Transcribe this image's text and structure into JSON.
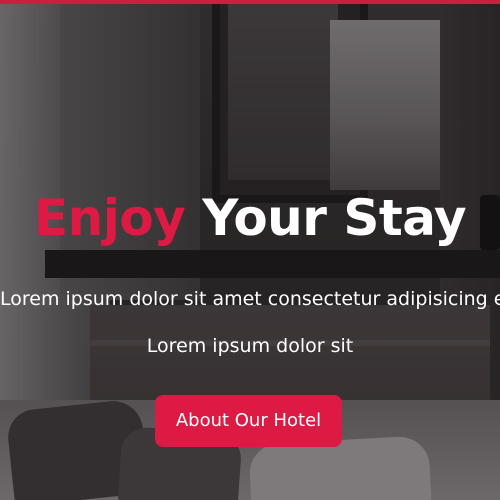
{
  "hero": {
    "title_accent": "Enjoy",
    "title_main": "Your Stay",
    "subtitle_line_1": "Lorem ipsum dolor sit amet consectetur adipisicing elit. Accusamus illo a",
    "subtitle_line_2": "Lorem ipsum dolor sit",
    "cta_label": "About Our Hotel"
  },
  "colors": {
    "accent": "#dc1a43",
    "top_bar": "#c8213f",
    "text": "#ffffff"
  }
}
